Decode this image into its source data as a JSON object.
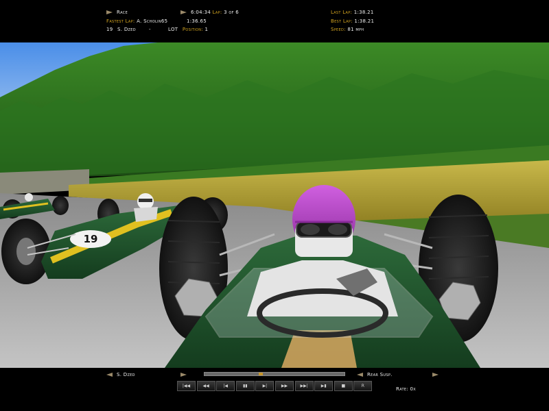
{
  "hud_top": {
    "mode_label": "Race",
    "time": "6:04:34",
    "lap_label": "Lap:",
    "lap_value": "3 of 6",
    "fastest_lap_label": "Fastest Lap:",
    "fastest_lap_driver": "A. Scholin65",
    "fastest_lap_time": "1:36.65",
    "driver_number": "19",
    "driver_name": "S. Dzed",
    "dash": "-",
    "team": "LOT",
    "position_label": "Position:",
    "position_value": "1",
    "last_lap_label": "Last Lap:",
    "last_lap_value": "1:38.21",
    "best_lap_label": "Best Lap:",
    "best_lap_value": "1:38.21",
    "speed_label": "Speed:",
    "speed_value": "81 mph"
  },
  "hud_bottom": {
    "driver_select": "S. Dzed",
    "camera_select": "Rear Susp.",
    "rate_label": "Rate: 0x",
    "replay_position": 0.4
  },
  "controls": [
    {
      "name": "skip-to-start",
      "symbol": "|◀◀"
    },
    {
      "name": "fast-rewind",
      "symbol": "◀◀"
    },
    {
      "name": "step-back",
      "symbol": "|◀"
    },
    {
      "name": "pause",
      "symbol": "▮▮"
    },
    {
      "name": "play",
      "symbol": "▶|"
    },
    {
      "name": "fast-forward",
      "symbol": "▶▶"
    },
    {
      "name": "skip-to-end",
      "symbol": "▶▶|"
    },
    {
      "name": "slow-motion",
      "symbol": "▶▮"
    },
    {
      "name": "stop",
      "symbol": "■"
    },
    {
      "name": "record",
      "symbol": "R"
    }
  ],
  "car": {
    "rival_number": "19"
  },
  "colors": {
    "hud_key": "#d4a520",
    "hud_value": "#f0f0f0",
    "car_green": "#1f5a2e",
    "car_stripe": "#e0c020",
    "helmet": "#b040c0"
  }
}
